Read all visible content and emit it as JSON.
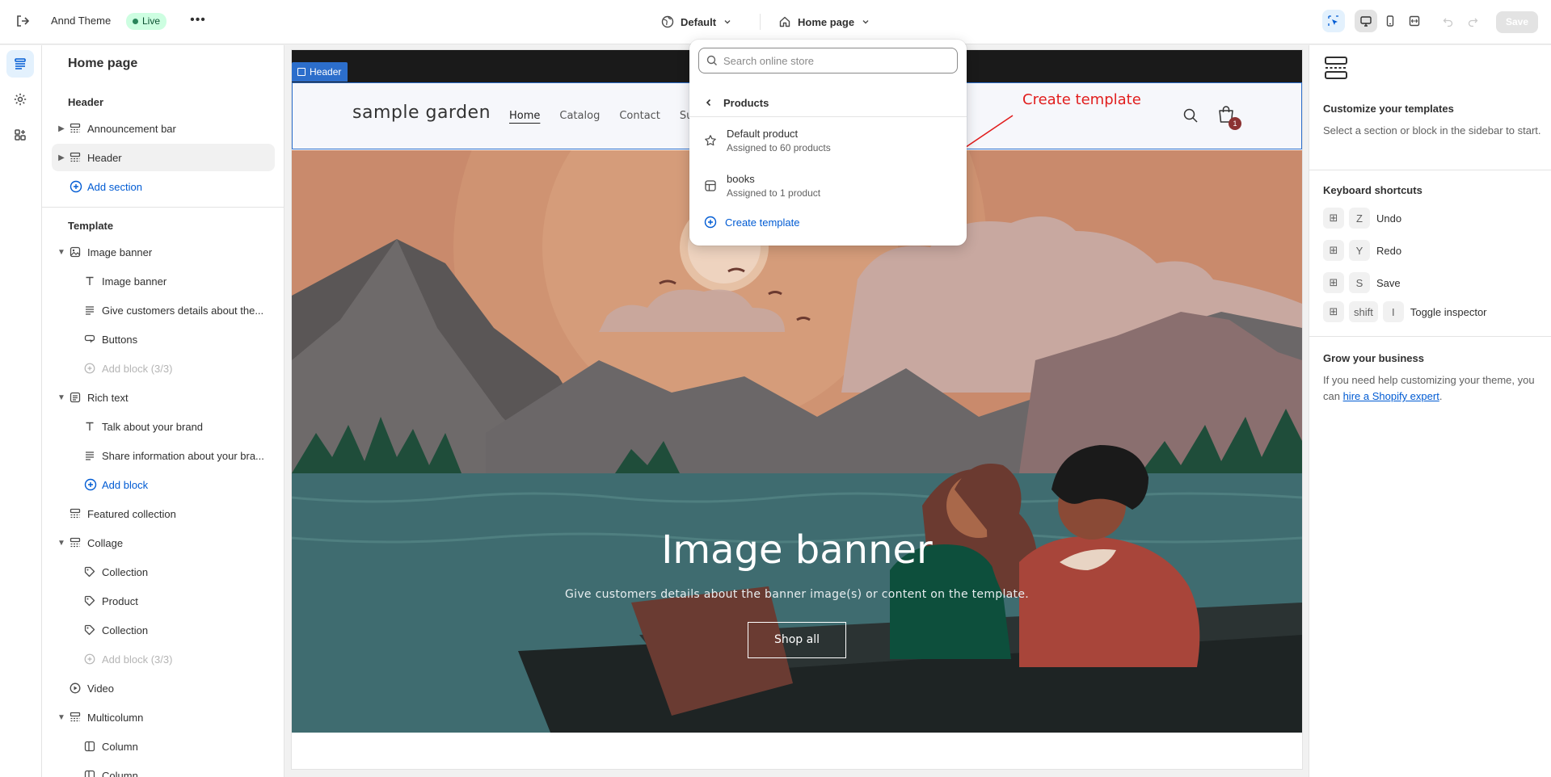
{
  "topbar": {
    "theme_name": "Annd Theme",
    "live_badge": "Live",
    "more_label": "•••",
    "template_selector": "Default",
    "page_selector": "Home page",
    "save_label": "Save"
  },
  "sidebar": {
    "title": "Home page",
    "header_section": {
      "heading": "Header",
      "items": [
        {
          "label": "Announcement bar"
        },
        {
          "label": "Header"
        }
      ],
      "add_label": "Add section"
    },
    "template_section": {
      "heading": "Template",
      "image_banner": "Image banner",
      "image_banner_blocks": [
        "Image banner",
        "Give customers details about the...",
        "Buttons"
      ],
      "image_banner_add": "Add block (3/3)",
      "rich_text": "Rich text",
      "rich_text_blocks": [
        "Talk about your brand",
        "Share information about your bra..."
      ],
      "rich_text_add": "Add block",
      "featured_collection": "Featured collection",
      "collage": "Collage",
      "collage_blocks": [
        "Collection",
        "Product",
        "Collection"
      ],
      "collage_add": "Add block (3/3)",
      "video": "Video",
      "multicolumn": "Multicolumn",
      "multicolumn_blocks": [
        "Column",
        "Column"
      ]
    }
  },
  "preview": {
    "header_tag": "Header",
    "logo": "sample garden",
    "nav": [
      "Home",
      "Catalog",
      "Contact",
      "Su"
    ],
    "cart_count": "1",
    "banner_title": "Image banner",
    "banner_subtitle": "Give customers details about the banner image(s) or content on the template.",
    "banner_button": "Shop all"
  },
  "dropdown": {
    "search_placeholder": "Search online store",
    "back_label": "Products",
    "items": [
      {
        "title": "Default product",
        "subtitle": "Assigned to 60 products"
      },
      {
        "title": "books",
        "subtitle": "Assigned to 1 product"
      }
    ],
    "create_label": "Create template"
  },
  "annotation": {
    "text": "Create template",
    "color": "#e11d1d"
  },
  "right_panel": {
    "title": "Customize your templates",
    "desc": "Select a section or block in the sidebar to start.",
    "shortcuts_heading": "Keyboard shortcuts",
    "shortcuts": [
      {
        "mod": "⊞",
        "key": "Z",
        "label": "Undo"
      },
      {
        "mod": "⊞",
        "key": "Y",
        "label": "Redo"
      },
      {
        "mod": "⊞",
        "key": "S",
        "label": "Save"
      },
      {
        "mod": "⊞",
        "key": "shift",
        "key2": "I",
        "label": "Toggle inspector"
      }
    ],
    "grow_heading": "Grow your business",
    "grow_text": "If you need help customizing your theme, you can ",
    "grow_link": "hire a Shopify expert",
    "grow_end": "."
  },
  "colors": {
    "accent": "#005bd3",
    "selection": "#2c6ecb",
    "live_bg": "#cdfee1",
    "annotation": "#e11d1d"
  }
}
